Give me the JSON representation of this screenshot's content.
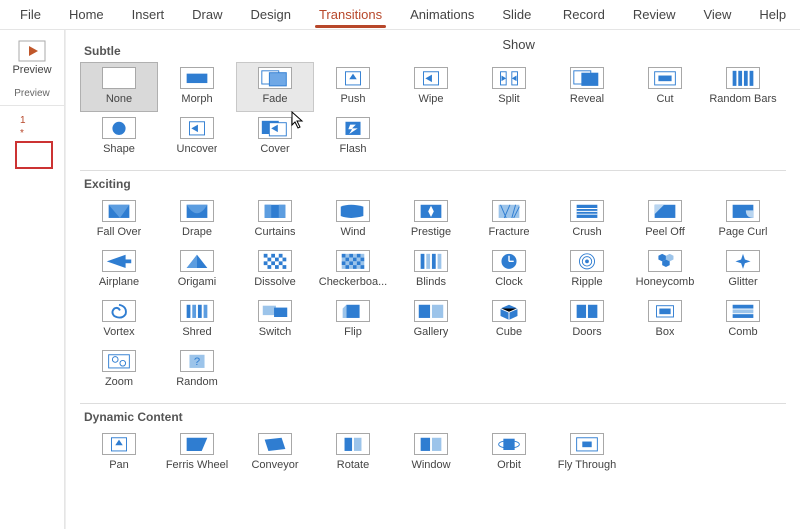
{
  "ribbon": {
    "tabs": [
      "File",
      "Home",
      "Insert",
      "Draw",
      "Design",
      "Transitions",
      "Animations",
      "Slide Show",
      "Record",
      "Review",
      "View",
      "Help"
    ],
    "active": "Transitions"
  },
  "preview": {
    "button_label": "Preview",
    "group_label": "Preview"
  },
  "thumbnail": {
    "slide_number": "1",
    "star": "*"
  },
  "sections": [
    {
      "title": "Subtle",
      "items": [
        {
          "label": "None",
          "icon": "none",
          "state": "selected"
        },
        {
          "label": "Morph",
          "icon": "morph"
        },
        {
          "label": "Fade",
          "icon": "fade",
          "state": "hovered"
        },
        {
          "label": "Push",
          "icon": "push"
        },
        {
          "label": "Wipe",
          "icon": "wipe"
        },
        {
          "label": "Split",
          "icon": "split"
        },
        {
          "label": "Reveal",
          "icon": "reveal"
        },
        {
          "label": "Cut",
          "icon": "cut"
        },
        {
          "label": "Random Bars",
          "icon": "randombars"
        },
        {
          "label": "Shape",
          "icon": "shape"
        },
        {
          "label": "Uncover",
          "icon": "uncover"
        },
        {
          "label": "Cover",
          "icon": "cover"
        },
        {
          "label": "Flash",
          "icon": "flash"
        }
      ]
    },
    {
      "title": "Exciting",
      "items": [
        {
          "label": "Fall Over",
          "icon": "fallover"
        },
        {
          "label": "Drape",
          "icon": "drape"
        },
        {
          "label": "Curtains",
          "icon": "curtains"
        },
        {
          "label": "Wind",
          "icon": "wind"
        },
        {
          "label": "Prestige",
          "icon": "prestige"
        },
        {
          "label": "Fracture",
          "icon": "fracture"
        },
        {
          "label": "Crush",
          "icon": "crush"
        },
        {
          "label": "Peel Off",
          "icon": "peeloff"
        },
        {
          "label": "Page Curl",
          "icon": "pagecurl"
        },
        {
          "label": "Airplane",
          "icon": "airplane"
        },
        {
          "label": "Origami",
          "icon": "origami"
        },
        {
          "label": "Dissolve",
          "icon": "dissolve"
        },
        {
          "label": "Checkerboa...",
          "icon": "checker"
        },
        {
          "label": "Blinds",
          "icon": "blinds"
        },
        {
          "label": "Clock",
          "icon": "clock"
        },
        {
          "label": "Ripple",
          "icon": "ripple"
        },
        {
          "label": "Honeycomb",
          "icon": "honeycomb"
        },
        {
          "label": "Glitter",
          "icon": "glitter"
        },
        {
          "label": "Vortex",
          "icon": "vortex"
        },
        {
          "label": "Shred",
          "icon": "shred"
        },
        {
          "label": "Switch",
          "icon": "switch"
        },
        {
          "label": "Flip",
          "icon": "flip"
        },
        {
          "label": "Gallery",
          "icon": "gallery"
        },
        {
          "label": "Cube",
          "icon": "cube"
        },
        {
          "label": "Doors",
          "icon": "doors"
        },
        {
          "label": "Box",
          "icon": "box"
        },
        {
          "label": "Comb",
          "icon": "comb"
        },
        {
          "label": "Zoom",
          "icon": "zoom"
        },
        {
          "label": "Random",
          "icon": "random"
        }
      ]
    },
    {
      "title": "Dynamic Content",
      "items": [
        {
          "label": "Pan",
          "icon": "pan"
        },
        {
          "label": "Ferris Wheel",
          "icon": "ferris"
        },
        {
          "label": "Conveyor",
          "icon": "conveyor"
        },
        {
          "label": "Rotate",
          "icon": "rotate"
        },
        {
          "label": "Window",
          "icon": "window"
        },
        {
          "label": "Orbit",
          "icon": "orbit"
        },
        {
          "label": "Fly Through",
          "icon": "flythrough"
        }
      ]
    }
  ]
}
